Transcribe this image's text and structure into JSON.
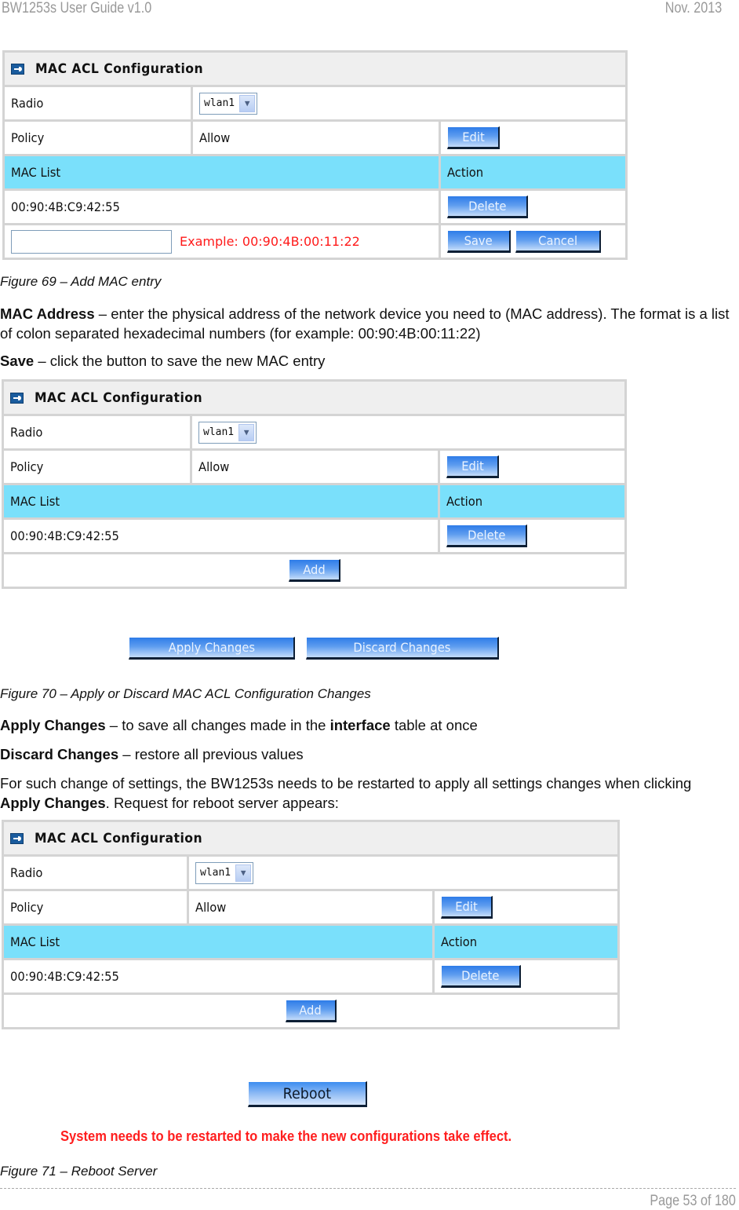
{
  "header": {
    "doc_title": "BW1253s User Guide v1.0",
    "date": "Nov.  2013"
  },
  "panel_common": {
    "title": "MAC ACL Configuration",
    "radio_label": "Radio",
    "radio_value": "wlan1",
    "policy_label": "Policy",
    "policy_value": "Allow",
    "edit_label": "Edit",
    "mac_list_header": "MAC List",
    "action_header": "Action",
    "mac_entries": [
      "00:90:4B:C9:42:55"
    ],
    "delete_label": "Delete",
    "add_label": "Add"
  },
  "figure69": {
    "input_value": "",
    "example_text": "Example: 00:90:4B:00:11:22",
    "save_label": "Save",
    "cancel_label": "Cancel",
    "caption": "Figure 69 – Add MAC entry"
  },
  "text1": {
    "mac_address_term": "MAC Address",
    "mac_address_desc": " – enter the physical address of the network device you need to (MAC address). The format is a list of colon separated hexadecimal numbers (for example: 00:90:4B:00:11:22)",
    "save_term": "Save",
    "save_desc": " – click the button to save the new MAC entry"
  },
  "figure70": {
    "apply_label": "Apply Changes",
    "discard_label": "Discard Changes",
    "caption": "Figure 70 – Apply or Discard MAC ACL Configuration Changes"
  },
  "text2": {
    "apply_term": "Apply Changes",
    "apply_desc_1": " – to save all changes made in the ",
    "apply_desc_bold": "interface",
    "apply_desc_2": " table at once",
    "discard_term": "Discard Changes",
    "discard_desc": " – restore all previous values",
    "restart_1": "For such change of settings, the BW1253s needs to be restarted to apply all settings changes when clicking ",
    "restart_bold": "Apply Changes",
    "restart_2": ". Request for reboot server appears:"
  },
  "figure71": {
    "reboot_label": "Reboot",
    "warning": "System needs to be restarted to make the new configurations take effect.",
    "caption": "Figure 71 – Reboot Server"
  },
  "footer": {
    "page": "Page 53 of 180"
  },
  "colors": {
    "cyan_header": "#7ae0fb",
    "button_blue": "#2e7ce8",
    "warning_red": "#ff1e1e"
  }
}
